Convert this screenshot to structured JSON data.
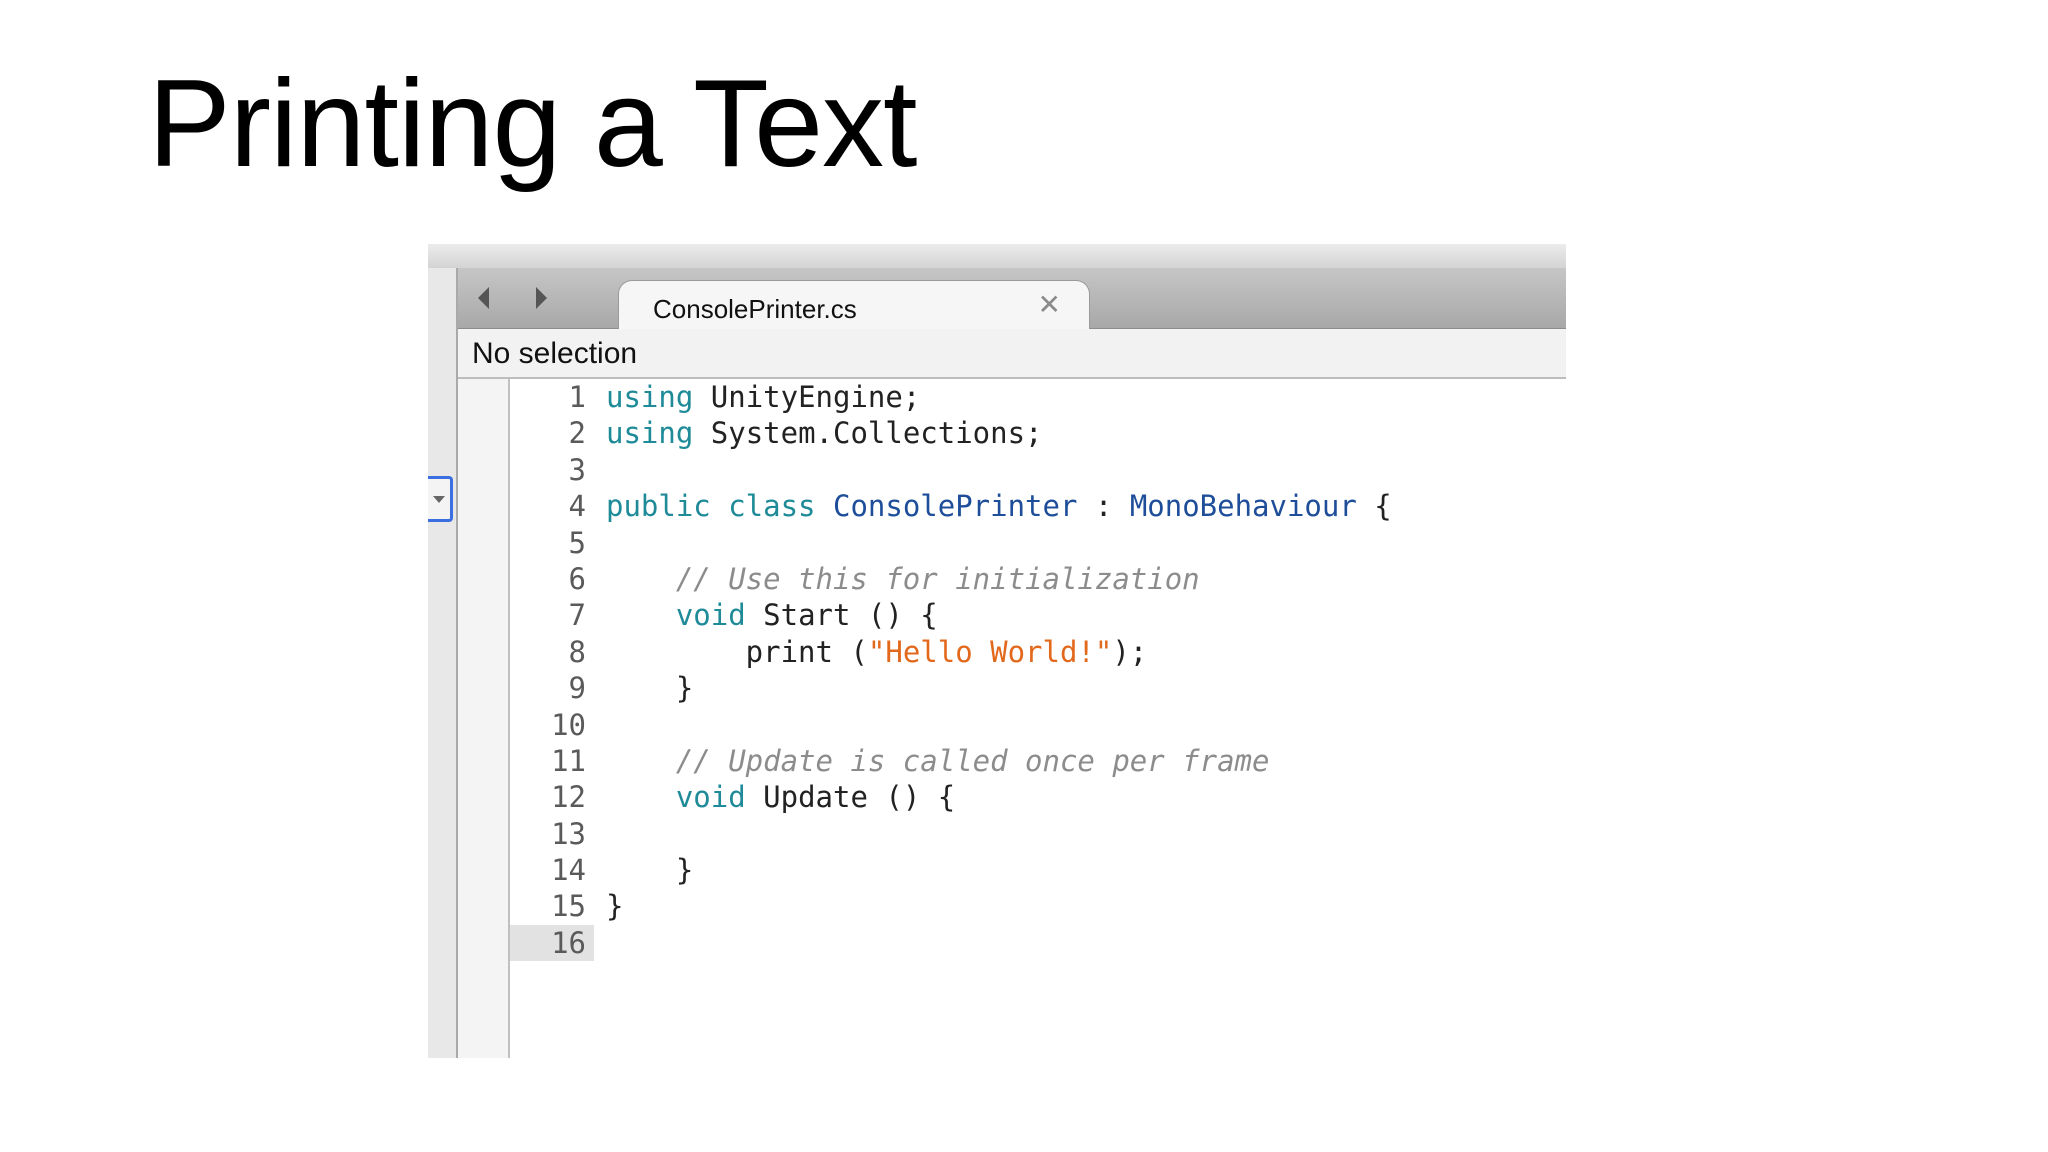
{
  "slide": {
    "title": "Printing a Text"
  },
  "editor_window": {
    "tab": {
      "filename": "ConsolePrinter.cs",
      "close_glyph": "✕"
    },
    "info_bar": {
      "text": "No selection"
    },
    "current_line": 16,
    "line_numbers": [
      "1",
      "2",
      "3",
      "4",
      "5",
      "6",
      "7",
      "8",
      "9",
      "10",
      "11",
      "12",
      "13",
      "14",
      "15",
      "16"
    ],
    "code_lines": [
      [
        {
          "t": "using",
          "c": "kw"
        },
        {
          "t": " UnityEngine;",
          "c": "pl"
        }
      ],
      [
        {
          "t": "using",
          "c": "kw"
        },
        {
          "t": " System.Collections;",
          "c": "pl"
        }
      ],
      [],
      [
        {
          "t": "public class",
          "c": "kw"
        },
        {
          "t": " ",
          "c": "pl"
        },
        {
          "t": "ConsolePrinter",
          "c": "tp"
        },
        {
          "t": " : ",
          "c": "pl"
        },
        {
          "t": "MonoBehaviour",
          "c": "tp"
        },
        {
          "t": " {",
          "c": "pl"
        }
      ],
      [],
      [
        {
          "t": "    // Use this for initialization",
          "c": "cm"
        }
      ],
      [
        {
          "t": "    ",
          "c": "pl"
        },
        {
          "t": "void",
          "c": "kw"
        },
        {
          "t": " Start () {",
          "c": "pl"
        }
      ],
      [
        {
          "t": "        print (",
          "c": "pl"
        },
        {
          "t": "\"Hello World!\"",
          "c": "st"
        },
        {
          "t": ");",
          "c": "pl"
        }
      ],
      [
        {
          "t": "    }",
          "c": "pl"
        }
      ],
      [],
      [
        {
          "t": "    // Update is called once per frame",
          "c": "cm"
        }
      ],
      [
        {
          "t": "    ",
          "c": "pl"
        },
        {
          "t": "void",
          "c": "kw"
        },
        {
          "t": " Update () {",
          "c": "pl"
        }
      ],
      [],
      [
        {
          "t": "    }",
          "c": "pl"
        }
      ],
      [
        {
          "t": "}",
          "c": "pl"
        }
      ],
      []
    ],
    "colors": {
      "keyword": "#1f8a98",
      "type": "#1e4e9a",
      "comment": "#8c8c8c",
      "string": "#e2691c",
      "plain": "#222222"
    },
    "icons": [
      "back-arrow-icon",
      "forward-arrow-icon",
      "close-icon",
      "dropdown-icon"
    ]
  }
}
